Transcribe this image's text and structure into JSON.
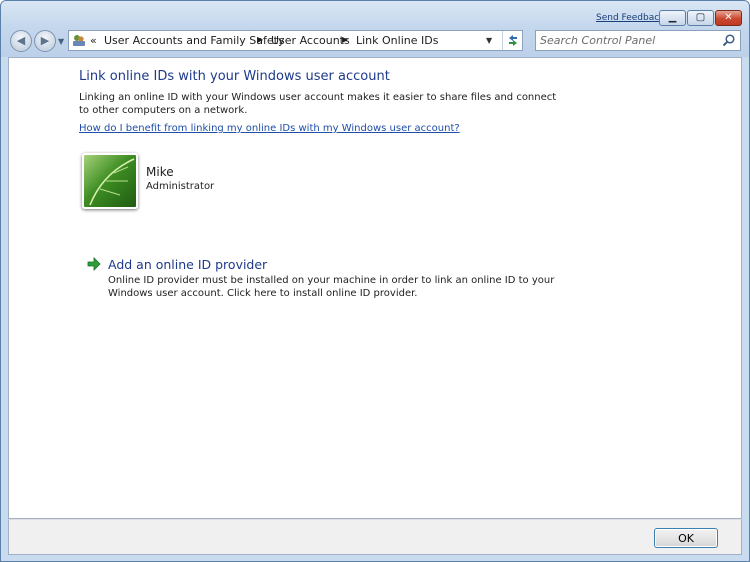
{
  "titlebar": {
    "send_feedback": "Send Feedback",
    "controls": {
      "minimize": "minimize-icon",
      "maximize": "maximize-icon",
      "close": "close-icon"
    }
  },
  "navigation": {
    "back_icon": "back-arrow-icon",
    "forward_icon": "forward-arrow-icon",
    "recent_icon": "chevron-down-icon"
  },
  "address_bar": {
    "overflow_chevron": "«",
    "crumbs": [
      "User Accounts and Family Safety",
      "User Accounts",
      "Link Online IDs"
    ],
    "icons": {
      "location": "control-panel-icon",
      "dropdown": "chevron-down-icon",
      "refresh": "refresh-icon"
    }
  },
  "search": {
    "placeholder": "Search Control Panel",
    "icon": "search-icon"
  },
  "main": {
    "title": "Link online IDs with your Windows user account",
    "description": "Linking an online ID with your Windows user account makes it easier to share files and connect to other computers on a network.",
    "help_link": "How do I benefit from linking my online IDs with my Windows user account?",
    "user": {
      "name": "Mike",
      "role": "Administrator",
      "avatar_icon": "user-avatar-leaf-icon"
    },
    "provider": {
      "icon": "green-arrow-icon",
      "title": "Add an online ID provider",
      "description": "Online ID provider must be installed on your machine in order to link an online ID to your Windows user account. Click here to install online ID provider."
    }
  },
  "footer": {
    "ok_label": "OK"
  },
  "colors": {
    "frame": "#c9dbee",
    "heading": "#1e3a8c",
    "link": "#1e4ea8",
    "ok_border": "#3c7fb1"
  }
}
